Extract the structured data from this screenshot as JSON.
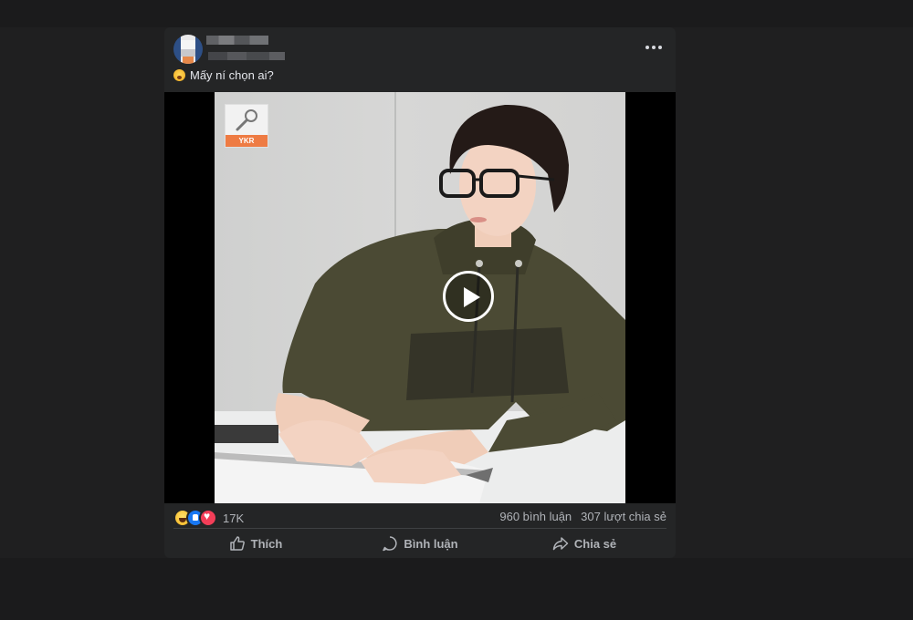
{
  "post": {
    "caption": "Mấy ní chọn ai?",
    "video": {
      "logo_text": "YKR",
      "state": "paused"
    },
    "stats": {
      "reaction_count": "17K",
      "comments": "960 bình luận",
      "shares": "307 lượt chia sẻ",
      "reactions": [
        "haha",
        "like",
        "love"
      ]
    },
    "actions": {
      "like_label": "Thích",
      "comment_label": "Bình luận",
      "share_label": "Chia sẻ"
    }
  },
  "colors": {
    "background": "#1b1b1c",
    "card": "#242526",
    "text_secondary": "#b0b3b8",
    "like_blue": "#1877f2",
    "love_red": "#f33e58",
    "logo_orange": "#ee7b43"
  },
  "icons": [
    "more-icon",
    "caption-emoji-icon",
    "microphone-icon",
    "play-icon",
    "like-icon",
    "comment-icon",
    "share-icon"
  ]
}
